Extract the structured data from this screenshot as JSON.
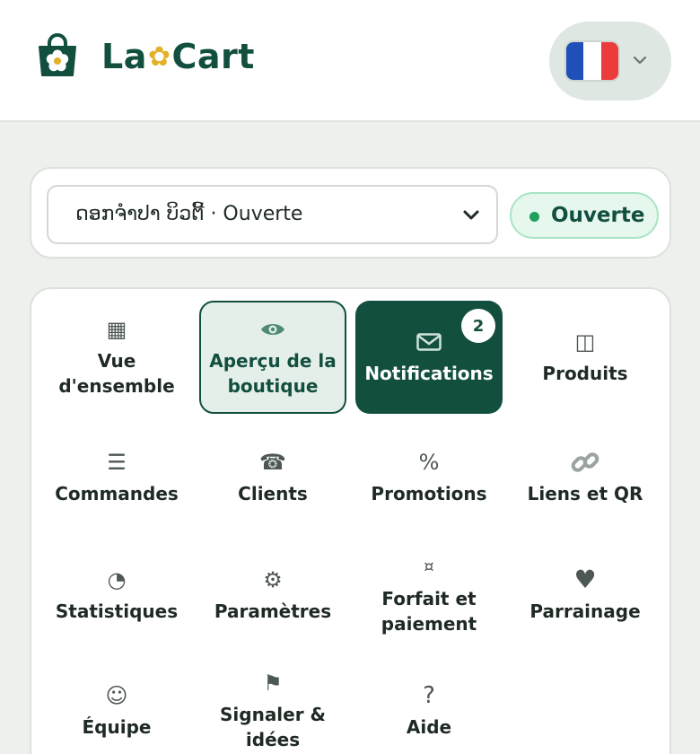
{
  "header": {
    "brand_prefix": "La",
    "brand_star": "✿",
    "brand_suffix": "Cart",
    "language_flag": "fr-flag-icon"
  },
  "store": {
    "selected": "ດອກຈຳປາ ບິວຕີ້ · Ouverte",
    "status_label": "Ouverte"
  },
  "menu": {
    "items": [
      {
        "label": "Vue\nd'ensemble",
        "icon": "▦"
      },
      {
        "label": "Aperçu de la\nboutique",
        "icon": "👁"
      },
      {
        "label": "Notifications",
        "icon": "✉",
        "badge": "2"
      },
      {
        "label": "Produits",
        "icon": "◫"
      },
      {
        "label": "Commandes",
        "icon": "☰"
      },
      {
        "label": "Clients",
        "icon": "☎"
      },
      {
        "label": "Promotions",
        "icon": "%"
      },
      {
        "label": "Liens et QR",
        "icon": "🔗"
      },
      {
        "label": "Statistiques",
        "icon": "◔"
      },
      {
        "label": "Paramètres",
        "icon": "⚙"
      },
      {
        "label": "Forfait et\npaiement",
        "icon": "¤"
      },
      {
        "label": "Parrainage",
        "icon": "♥"
      },
      {
        "label": "Équipe",
        "icon": "☺"
      },
      {
        "label": "Signaler &\nidées",
        "icon": "⚑"
      },
      {
        "label": "Aide",
        "icon": "?"
      }
    ]
  },
  "colors": {
    "brand": "#124f3f",
    "accent": "#e2b228",
    "status": "#1fa05a"
  }
}
